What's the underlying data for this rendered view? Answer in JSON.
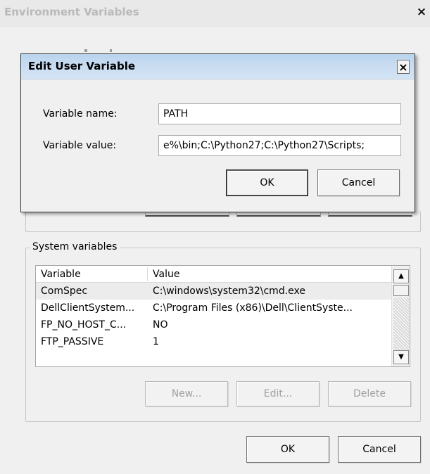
{
  "outer_window": {
    "title": "Environment Variables",
    "close_glyph": "×",
    "system_variables": {
      "group_label": "System variables",
      "columns": [
        "Variable",
        "Value"
      ],
      "rows": [
        {
          "variable": "ComSpec",
          "value": "C:\\windows\\system32\\cmd.exe"
        },
        {
          "variable": "DellClientSystem...",
          "value": "C:\\Program Files (x86)\\Dell\\ClientSyste..."
        },
        {
          "variable": "FP_NO_HOST_C...",
          "value": "NO"
        },
        {
          "variable": "FTP_PASSIVE",
          "value": "1"
        }
      ],
      "new_button": "New...",
      "edit_button": "Edit...",
      "delete_button": "Delete"
    },
    "ok_button": "OK",
    "cancel_button": "Cancel"
  },
  "dialog": {
    "title": "Edit User Variable",
    "close_glyph": "×",
    "name_label": "Variable name:",
    "value_label": "Variable value:",
    "name_value": "PATH",
    "value_value": "e%\\bin;C:\\Python27;C:\\Python27\\Scripts;",
    "ok_button": "OK",
    "cancel_button": "Cancel"
  },
  "icons": {
    "scroll_up": "▲",
    "scroll_down": "▼"
  }
}
